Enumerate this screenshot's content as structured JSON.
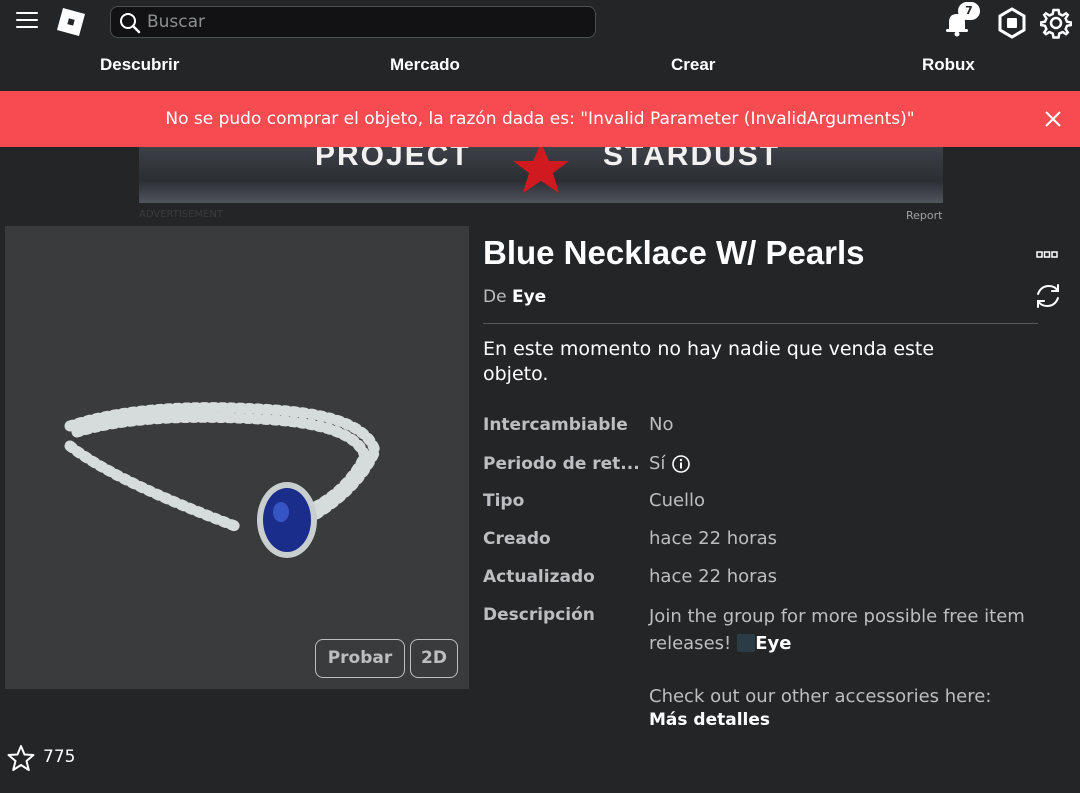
{
  "search": {
    "placeholder": "Buscar"
  },
  "notifications": {
    "count": "7"
  },
  "nav": {
    "items": [
      "Descubrir",
      "Mercado",
      "Crear",
      "Robux"
    ]
  },
  "banner": {
    "message": "No se pudo comprar el objeto, la razón dada es: \"Invalid Parameter (InvalidArguments)\"",
    "color": "#f74b52"
  },
  "ad": {
    "headline_left": "PROJECT",
    "headline_right": "STARDUST",
    "label": "ADVERTISEMENT",
    "report": "Report"
  },
  "item": {
    "title": "Blue Necklace W/ Pearls",
    "by_prefix": "De",
    "creator": "Eye",
    "availability": "En este momento no hay nadie que venda este objeto.",
    "favorites": "775",
    "try_on": "Probar",
    "view_2d": "2D"
  },
  "details": {
    "tradable_label": "Intercambiable",
    "tradable_value": "No",
    "hold_label": "Periodo de ret...",
    "hold_value": "Sí",
    "type_label": "Tipo",
    "type_value": "Cuello",
    "created_label": "Creado",
    "created_value": "hace 22 horas",
    "updated_label": "Actualizado",
    "updated_value": "hace 22 horas",
    "description_label": "Descripción",
    "description_text": "Join the group for more possible free item releases!",
    "description_mention": "Eye",
    "description_more": "Check out our other accessories here:",
    "more_details": "Más detalles"
  }
}
